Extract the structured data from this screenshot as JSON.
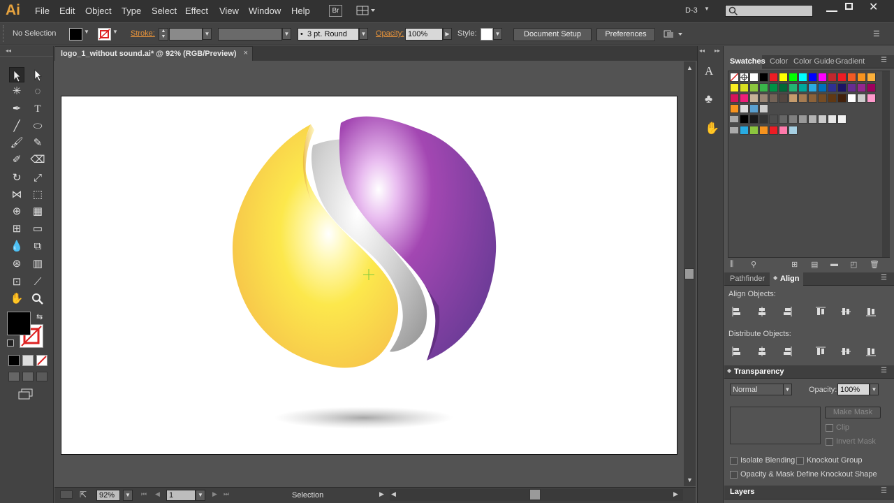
{
  "app": {
    "logo": "Ai"
  },
  "menu": [
    "File",
    "Edit",
    "Object",
    "Type",
    "Select",
    "Effect",
    "View",
    "Window",
    "Help"
  ],
  "menubar_right": {
    "br": "Br",
    "workspace": "D-3",
    "search_placeholder": ""
  },
  "control": {
    "selection": "No Selection",
    "stroke_label": "Stroke:",
    "brush": "3 pt. Round",
    "brush_dot": "•",
    "opacity_label": "Opacity:",
    "opacity_value": "100%",
    "style_label": "Style:",
    "doc_setup": "Document Setup",
    "preferences": "Preferences"
  },
  "document": {
    "tab_title": "logo_1_without sound.ai* @ 92% (RGB/Preview)",
    "close": "×"
  },
  "status": {
    "zoom": "92%",
    "page": "1",
    "tool": "Selection"
  },
  "dock": {
    "text_icon": "A"
  },
  "swatches_panel": {
    "tabs": [
      "Swatches",
      "Color",
      "Color Guide",
      "Gradient"
    ],
    "rows": [
      [
        "#ffffff",
        "#ffffff",
        "#ffffff",
        "#000000",
        "#ed1c24",
        "#ffff00",
        "#00ff00",
        "#00ffff",
        "#0000ff",
        "#ff00ff",
        "#c1272d",
        "#ed1c24",
        "#f15a24",
        "#f7931e",
        "#fbb03b"
      ],
      [
        "#fcee21",
        "#d9e021",
        "#8cc63f",
        "#39b54a",
        "#009245",
        "#006837",
        "#22b573",
        "#00a99d",
        "#29abe2",
        "#0071bc",
        "#2e3192",
        "#1b1464",
        "#662d91",
        "#93278f",
        "#9e005d"
      ],
      [
        "#d4145a",
        "#ed1e79",
        "#c7b299",
        "#998675",
        "#736357",
        "#534741",
        "#c69c6d",
        "#a67c52",
        "#8c6239",
        "#754c24",
        "#603813",
        "#42210b",
        "#ffffff",
        "#cccccc",
        "#ff99cc"
      ],
      [
        "#f7931e",
        "#dddddd",
        "#5aa0d0",
        "#cccccc"
      ],
      [
        "#000000",
        "#1a1a1a",
        "#333333",
        "#4d4d4d",
        "#666666",
        "#808080",
        "#999999",
        "#b3b3b3",
        "#cccccc",
        "#e6e6e6",
        "#f2f2f2"
      ],
      [
        "#29abe2",
        "#8cc63f",
        "#f7931e",
        "#ed1c24",
        "#ff7bac",
        "#a6cfe2"
      ]
    ]
  },
  "align_panel": {
    "tabs": [
      "Pathfinder",
      "Align"
    ],
    "align_objects": "Align Objects:",
    "distribute_objects": "Distribute Objects:"
  },
  "transparency_panel": {
    "title": "Transparency",
    "blend_mode": "Normal",
    "opacity_label": "Opacity:",
    "opacity_value": "100%",
    "make_mask": "Make Mask",
    "clip": "Clip",
    "invert_mask": "Invert Mask",
    "isolate": "Isolate Blending",
    "knockout": "Knockout Group",
    "opacity_mask": "Opacity & Mask Define Knockout Shape"
  },
  "layers_panel": {
    "title": "Layers"
  },
  "colors": {
    "accent": "#e9943a",
    "yellow": "#f7cf3a",
    "purple": "#7a3a9c",
    "silver": "#c8c8c8"
  }
}
